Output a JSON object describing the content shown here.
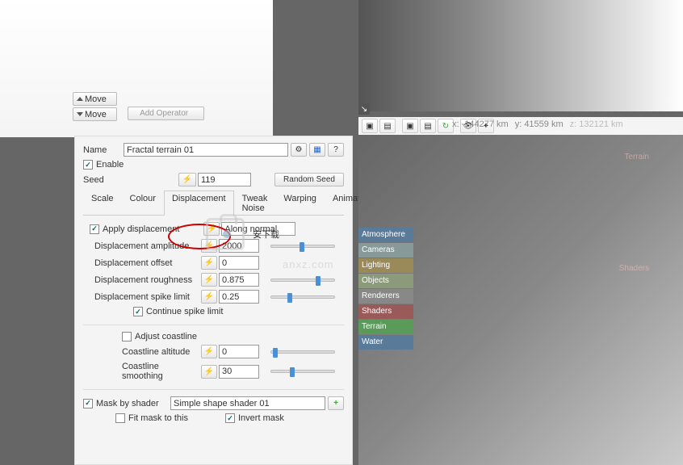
{
  "top_panel": {
    "move_up": "Move",
    "move_down": "Move",
    "add_operator": "Add Operator"
  },
  "form": {
    "name_lbl": "Name",
    "name_val": "Fractal terrain 01",
    "enable_lbl": "Enable",
    "enable_checked": "✓",
    "seed_lbl": "Seed",
    "seed_val": "119",
    "random_seed": "Random Seed"
  },
  "tabs": {
    "scale": "Scale",
    "colour": "Colour",
    "displacement": "Displacement",
    "tweak": "Tweak Noise",
    "warping": "Warping",
    "animation": "Animation"
  },
  "disp": {
    "apply": "Apply displacement",
    "apply_chk": "✓",
    "along": "Along normal",
    "amp_lbl": "Displacement amplitude",
    "amp_val": "2000",
    "off_lbl": "Displacement offset",
    "off_val": "0",
    "rough_lbl": "Displacement roughness",
    "rough_val": "0.875",
    "spike_lbl": "Displacement spike limit",
    "spike_val": "0.25",
    "cont": "Continue spike limit",
    "cont_chk": "✓",
    "adjust": "Adjust coastline",
    "calt_lbl": "Coastline altitude",
    "calt_val": "0",
    "csmooth_lbl": "Coastline smoothing",
    "csmooth_val": "30"
  },
  "mask": {
    "by": "Mask by shader",
    "by_chk": "✓",
    "val": "Simple shape shader 01",
    "fit": "Fit mask to this",
    "invert": "Invert mask",
    "invert_chk": "✓"
  },
  "coords": {
    "x": "x: -144277 km",
    "y": "y: 41559 km",
    "z": "z: 132121 km"
  },
  "cats": {
    "atmo": "Atmosphere",
    "cam": "Cameras",
    "light": "Lighting",
    "obj": "Objects",
    "rend": "Renderers",
    "shade": "Shaders",
    "terr": "Terrain",
    "water": "Water"
  },
  "nodes": {
    "terr": "Terrain",
    "shad": "Shaders"
  },
  "watermark": {
    "text": "安下载",
    "url": "anxz.com"
  }
}
